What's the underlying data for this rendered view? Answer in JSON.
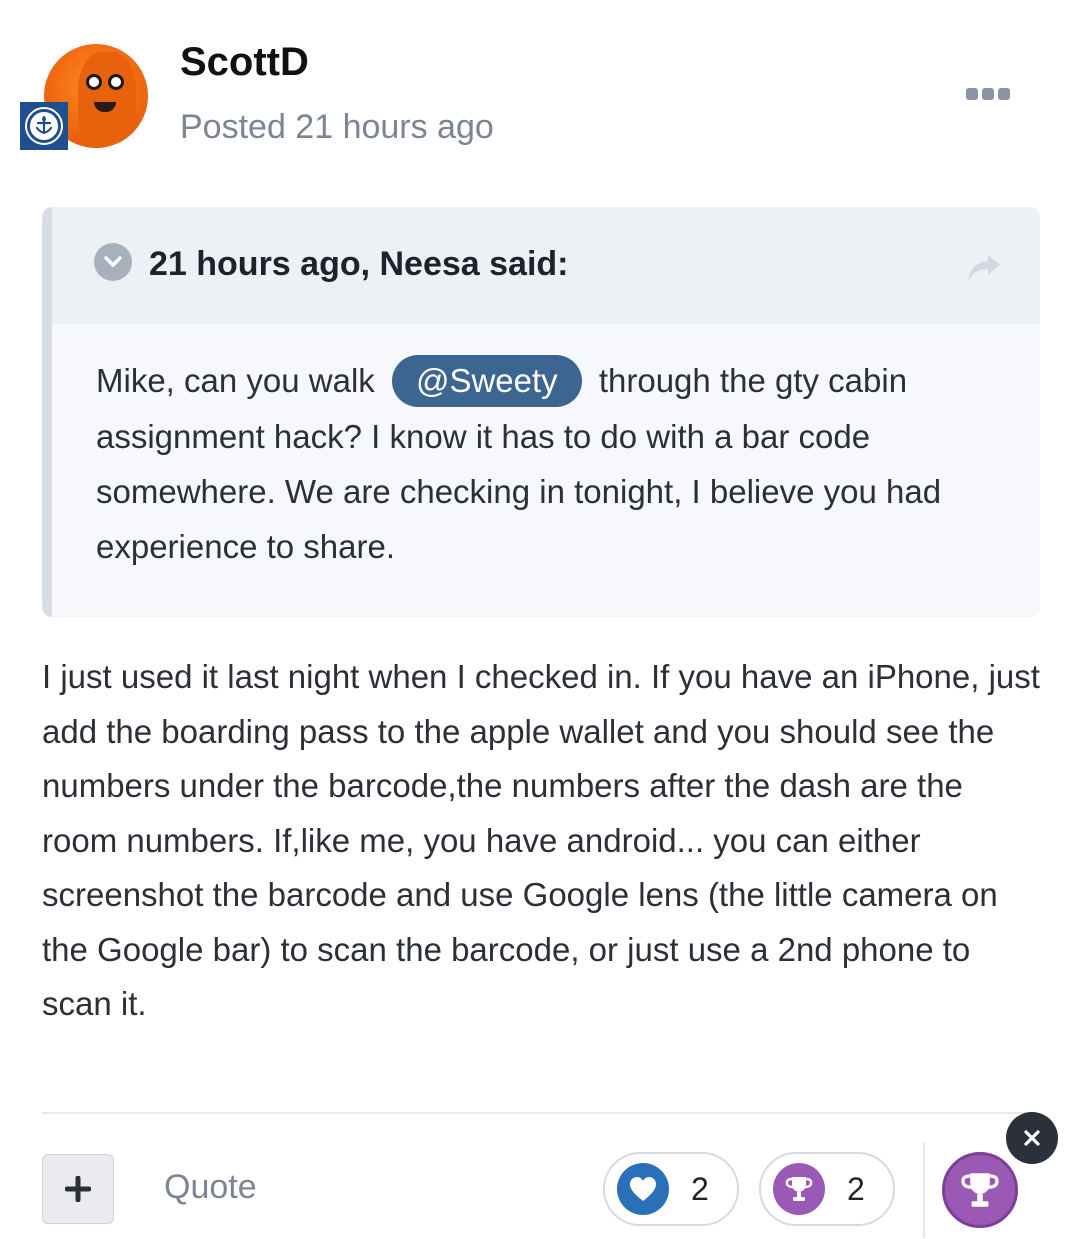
{
  "author": {
    "username": "ScottD",
    "posted": "Posted 21 hours ago"
  },
  "quote": {
    "citation": "21 hours ago, Neesa said:",
    "text_before": "Mike, can you walk",
    "mention": "@Sweety",
    "text_after": "through the gty cabin assignment hack? I know it has to do with a bar code somewhere. We are checking in tonight, I believe you had experience to share."
  },
  "post": {
    "body": "I just used it last night when I checked in. If you have an iPhone, just add the boarding pass to the apple wallet and you should see the numbers under the barcode,the numbers after the dash are the room numbers. If,like me, you have android... you can either screenshot the barcode and use Google lens (the little camera on the Google bar) to scan the barcode, or just use a 2nd phone to scan it."
  },
  "actions": {
    "quote_label": "Quote",
    "like_count": "2",
    "trophy_count": "2"
  },
  "icons": {
    "more": "ellipsis-icon",
    "toggle": "chevron-down-icon",
    "share": "share-arrow-icon",
    "plus": "plus-icon",
    "like": "heart-icon",
    "trophy": "trophy-icon",
    "close": "close-icon"
  },
  "colors": {
    "mention_bg": "#3d6592",
    "like": "#2a70b8",
    "trophy": "#9b59b6",
    "badge": "#1f4f8f"
  }
}
